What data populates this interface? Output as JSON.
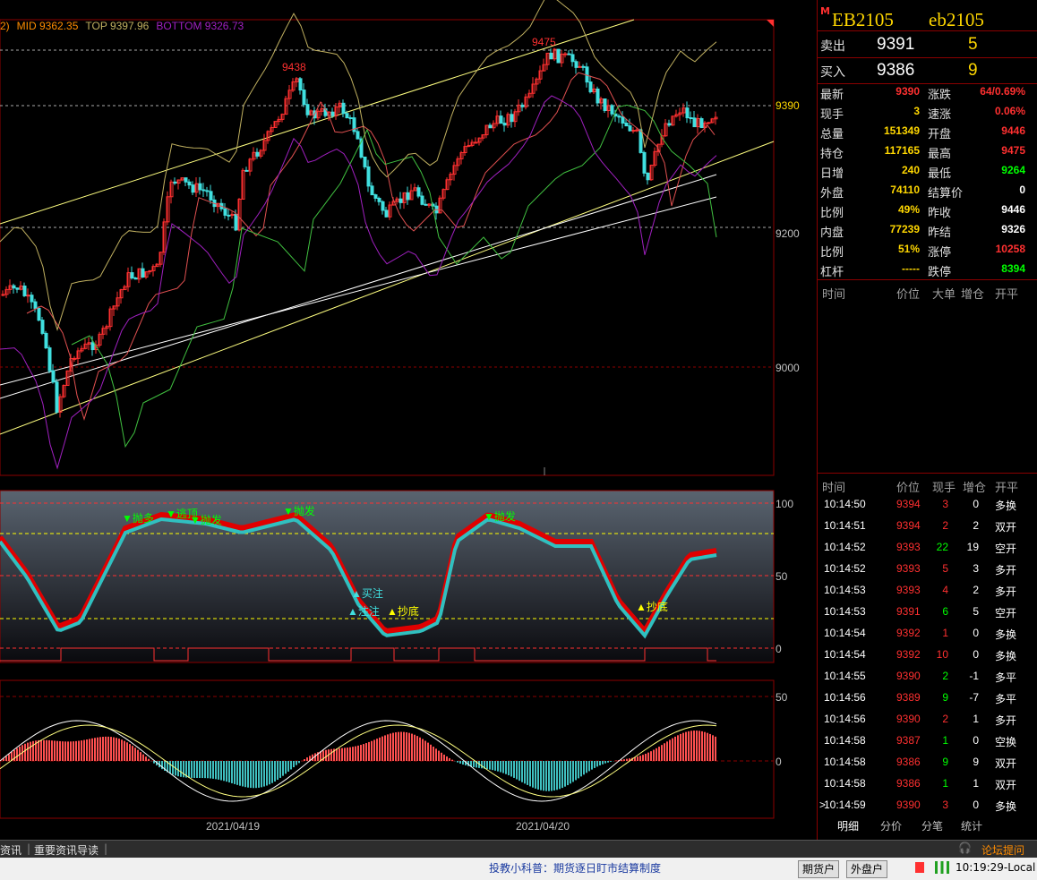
{
  "legend": {
    "prefix": "2)",
    "mid": "MID 9362.35",
    "top": "TOP 9397.96",
    "bottom": "BOTTOM 9326.73"
  },
  "price_axis": [
    "9390",
    "9200",
    "9000"
  ],
  "osc_axis": [
    "100",
    "50",
    "0"
  ],
  "macd_axis": [
    "50",
    "0"
  ],
  "dates": [
    "2021/04/19",
    "2021/04/20"
  ],
  "peaks": [
    "9438",
    "9475"
  ],
  "signals": {
    "a1": "买注",
    "a2": "注注",
    "a3": "抄底",
    "a4": "抄底",
    "b1": "抛多",
    "b2": "逃顶",
    "b3": "抛发",
    "b4": "抛发",
    "b5": "抛发"
  },
  "contract": {
    "flag": "M",
    "name": "EB2105",
    "code": "eb2105"
  },
  "orders": {
    "sell": {
      "label": "卖出",
      "price": "9391",
      "vol": "5"
    },
    "buy": {
      "label": "买入",
      "price": "9386",
      "vol": "9"
    }
  },
  "stats_left": [
    {
      "label": "最新",
      "value": "9390",
      "color": "#ff3030"
    },
    {
      "label": "现手",
      "value": "3",
      "color": "#ffd700"
    },
    {
      "label": "总量",
      "value": "151349",
      "color": "#ffd700"
    },
    {
      "label": "持仓",
      "value": "117165",
      "color": "#ffd700"
    },
    {
      "label": "日增",
      "value": "240",
      "color": "#ffd700"
    },
    {
      "label": "外盘",
      "value": "74110",
      "color": "#ffd700"
    },
    {
      "label": "比例",
      "value": "49%",
      "color": "#ffd700"
    },
    {
      "label": "内盘",
      "value": "77239",
      "color": "#ffd700"
    },
    {
      "label": "比例",
      "value": "51%",
      "color": "#ffd700"
    },
    {
      "label": "杠杆",
      "value": "-----",
      "color": "#ffd700"
    }
  ],
  "stats_right": [
    {
      "label": "涨跌",
      "value": "64/0.69%",
      "color": "#ff3030"
    },
    {
      "label": "速涨",
      "value": "0.06%",
      "color": "#ff3030"
    },
    {
      "label": "开盘",
      "value": "9446",
      "color": "#ff3030"
    },
    {
      "label": "最高",
      "value": "9475",
      "color": "#ff3030"
    },
    {
      "label": "最低",
      "value": "9264",
      "color": "#00ff00"
    },
    {
      "label": "结算价",
      "value": "0",
      "color": "#ffffff"
    },
    {
      "label": "昨收",
      "value": "9446",
      "color": "#ffffff"
    },
    {
      "label": "昨结",
      "value": "9326",
      "color": "#ffffff"
    },
    {
      "label": "涨停",
      "value": "10258",
      "color": "#ff3030"
    },
    {
      "label": "跌停",
      "value": "8394",
      "color": "#00ff00"
    }
  ],
  "big_order_header": {
    "time": "时间",
    "price": "价位",
    "big": "大单",
    "inc": "增仓",
    "open": "开平"
  },
  "trades_header": {
    "time": "时间",
    "price": "价位",
    "vol": "现手",
    "inc": "增仓",
    "open": "开平"
  },
  "trades": [
    {
      "time": "10:14:50",
      "price": "9394",
      "vol": "3",
      "inc": "0",
      "type": "多换",
      "vc": "#ff3030",
      "ic": "#ffffff"
    },
    {
      "time": "10:14:51",
      "price": "9394",
      "vol": "2",
      "inc": "2",
      "type": "双开",
      "vc": "#ff3030",
      "ic": "#ffffff"
    },
    {
      "time": "10:14:52",
      "price": "9393",
      "vol": "22",
      "inc": "19",
      "type": "空开",
      "vc": "#00ff00",
      "ic": "#ffffff"
    },
    {
      "time": "10:14:52",
      "price": "9393",
      "vol": "5",
      "inc": "3",
      "type": "多开",
      "vc": "#ff3030",
      "ic": "#ffffff"
    },
    {
      "time": "10:14:53",
      "price": "9393",
      "vol": "4",
      "inc": "2",
      "type": "多开",
      "vc": "#ff3030",
      "ic": "#ffffff"
    },
    {
      "time": "10:14:53",
      "price": "9391",
      "vol": "6",
      "inc": "5",
      "type": "空开",
      "vc": "#00ff00",
      "ic": "#ffffff"
    },
    {
      "time": "10:14:54",
      "price": "9392",
      "vol": "1",
      "inc": "0",
      "type": "多换",
      "vc": "#ff3030",
      "ic": "#ffffff"
    },
    {
      "time": "10:14:54",
      "price": "9392",
      "vol": "10",
      "inc": "0",
      "type": "多换",
      "vc": "#ff3030",
      "ic": "#ffffff"
    },
    {
      "time": "10:14:55",
      "price": "9390",
      "vol": "2",
      "inc": "-1",
      "type": "多平",
      "vc": "#00ff00",
      "ic": "#ffffff"
    },
    {
      "time": "10:14:56",
      "price": "9389",
      "vol": "9",
      "inc": "-7",
      "type": "多平",
      "vc": "#00ff00",
      "ic": "#ffffff"
    },
    {
      "time": "10:14:56",
      "price": "9390",
      "vol": "2",
      "inc": "1",
      "type": "多开",
      "vc": "#ff3030",
      "ic": "#ffffff"
    },
    {
      "time": "10:14:58",
      "price": "9387",
      "vol": "1",
      "inc": "0",
      "type": "空换",
      "vc": "#00ff00",
      "ic": "#ffffff"
    },
    {
      "time": "10:14:58",
      "price": "9386",
      "vol": "9",
      "inc": "9",
      "type": "双开",
      "vc": "#00ff00",
      "ic": "#ffffff"
    },
    {
      "time": "10:14:58",
      "price": "9386",
      "vol": "1",
      "inc": "1",
      "type": "双开",
      "vc": "#00ff00",
      "ic": "#ffffff"
    },
    {
      "time": "10:14:59",
      "price": "9390",
      "vol": "3",
      "inc": "0",
      "type": "多换",
      "vc": "#ff3030",
      "ic": "#ffffff",
      "marker": ">"
    }
  ],
  "tabs": [
    "明细",
    "分价",
    "分笔",
    "统计"
  ],
  "news": {
    "item1": "资讯",
    "item2": "重要资讯导读",
    "forum": "论坛提问"
  },
  "status": {
    "ticker": "投教小科普：期货逐日盯市结算制度",
    "btn1": "期货户",
    "btn2": "外盘户",
    "time": "10:19:29-Local"
  },
  "colors": {
    "up": "#ff3030",
    "down": "#00ff00",
    "accent": "#ffd700",
    "grid": "#8b0000"
  }
}
